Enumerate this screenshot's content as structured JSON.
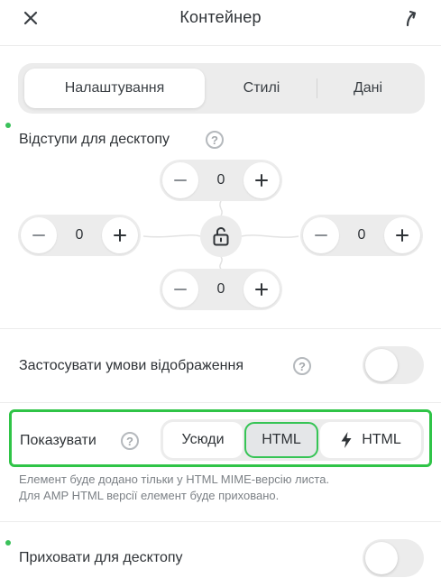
{
  "header": {
    "title": "Контейнер",
    "close_icon": "close-icon",
    "action_icon": "arrow-up-turn-icon"
  },
  "tabs": [
    {
      "label": "Налаштування",
      "active": true
    },
    {
      "label": "Стилі",
      "active": false
    },
    {
      "label": "Дані",
      "active": false
    }
  ],
  "padding": {
    "label": "Відступи для десктопу",
    "top": "0",
    "left": "0",
    "right": "0",
    "bottom": "0",
    "lock_icon": "unlocked-padlock-icon"
  },
  "conditions": {
    "label": "Застосувати умови відображення",
    "enabled": false
  },
  "show": {
    "label": "Показувати",
    "options": [
      {
        "label": "Усюди",
        "selected": false
      },
      {
        "label": "HTML",
        "selected": true
      },
      {
        "label": "HTML",
        "icon": "lightning-icon",
        "selected": false
      }
    ],
    "hint_line1": "Елемент буде додано тільки у HTML MIME-версію листа.",
    "hint_line2": "Для AMP HTML версії елемент буде приховано."
  },
  "hide_desktop": {
    "label": "Приховати для десктопу",
    "enabled": false
  },
  "colors": {
    "accent_green": "#2fc447",
    "indicator_dot": "#3ac15a",
    "control_bg": "#ececec",
    "text": "#2f3337"
  }
}
